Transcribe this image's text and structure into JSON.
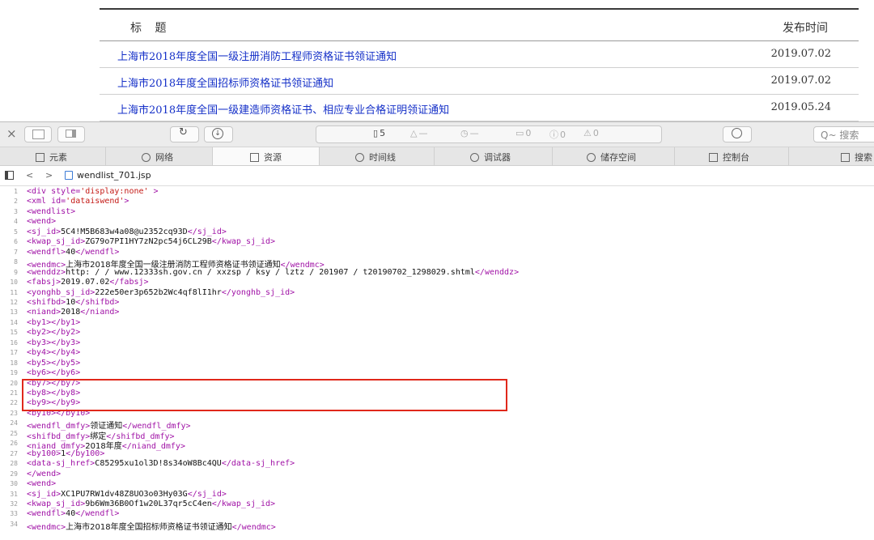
{
  "webpage": {
    "header": {
      "title": "标 题",
      "date": "发布时间"
    },
    "rows": [
      {
        "title": "上海市2018年度全国一级注册消防工程师资格证书领证通知",
        "date": "2019.07.02"
      },
      {
        "title": "上海市2018年度全国招标师资格证书领证通知",
        "date": "2019.07.02"
      },
      {
        "title": "上海市2018年度全国一级建造师资格证书、相应专业合格证明领证通知",
        "date": "2019.05.24"
      }
    ]
  },
  "devtools": {
    "toolbar": {
      "close": "×",
      "counts": [
        {
          "icon": "document-icon",
          "value": "5"
        },
        {
          "icon": "weight-icon",
          "value": "—"
        },
        {
          "icon": "clock-icon",
          "value": "—"
        },
        {
          "icon": "log-icon",
          "value": "0"
        },
        {
          "icon": "info-icon",
          "value": "0"
        },
        {
          "icon": "warning-icon",
          "value": "0"
        }
      ],
      "search_placeholder": "Q~ 搜索"
    },
    "tabs": [
      {
        "label": "元素",
        "icon": "elements-icon"
      },
      {
        "label": "网络",
        "icon": "network-icon"
      },
      {
        "label": "资源",
        "icon": "resources-icon",
        "active": true
      },
      {
        "label": "时间线",
        "icon": "timeline-icon"
      },
      {
        "label": "调试器",
        "icon": "debugger-icon"
      },
      {
        "label": "储存空间",
        "icon": "storage-icon"
      },
      {
        "label": "控制台",
        "icon": "console-icon"
      },
      {
        "label": "搜索",
        "icon": "search-icon"
      }
    ],
    "path": {
      "file": "wendlist_701.jsp"
    },
    "code_lines": [
      {
        "n": "1",
        "parts": [
          [
            "t",
            "<div "
          ],
          [
            "t",
            "style="
          ],
          [
            "a",
            "'display:none'"
          ],
          [
            "t",
            " >"
          ]
        ]
      },
      {
        "n": "2",
        "parts": [
          [
            "t",
            "<xml "
          ],
          [
            "t",
            "id="
          ],
          [
            "a",
            "'dataiswend'"
          ],
          [
            "t",
            ">"
          ]
        ]
      },
      {
        "n": "3",
        "parts": [
          [
            "t",
            "<wendlist>"
          ]
        ]
      },
      {
        "n": "4",
        "parts": [
          [
            "t",
            "<wend>"
          ]
        ]
      },
      {
        "n": "5",
        "parts": [
          [
            "t",
            "<sj_id>"
          ],
          [
            "x",
            "5C4!M5B683w4a08@u2352cq93D"
          ],
          [
            "t",
            "</sj_id>"
          ]
        ]
      },
      {
        "n": "6",
        "parts": [
          [
            "t",
            "<kwap_sj_id>"
          ],
          [
            "x",
            "ZG79o7PI1HY7zN2pc54j6CL29B"
          ],
          [
            "t",
            "</kwap_sj_id>"
          ]
        ]
      },
      {
        "n": "7",
        "parts": [
          [
            "t",
            "<wendfl>"
          ],
          [
            "x",
            "40"
          ],
          [
            "t",
            "</wendfl>"
          ]
        ]
      },
      {
        "n": "8",
        "parts": [
          [
            "t",
            "<wendmc>"
          ],
          [
            "c",
            "上海市2018年度全国一级注册消防工程师资格证书领证通知"
          ],
          [
            "t",
            "</wendmc>"
          ]
        ]
      },
      {
        "n": "9",
        "parts": [
          [
            "t",
            "<wenddz>"
          ],
          [
            "x",
            "http: / / www.12333sh.gov.cn / xxzsp / ksy / lztz / 201907 / t20190702_1298029.shtml"
          ],
          [
            "t",
            "</wenddz>"
          ]
        ]
      },
      {
        "n": "10",
        "parts": [
          [
            "t",
            "<fabsj>"
          ],
          [
            "x",
            "2019.07.02"
          ],
          [
            "t",
            "</fabsj>"
          ]
        ]
      },
      {
        "n": "11",
        "parts": [
          [
            "t",
            "<yonghb_sj_id>"
          ],
          [
            "x",
            "222e50er3p652b2Wc4qf8lI1hr"
          ],
          [
            "t",
            "</yonghb_sj_id>"
          ]
        ]
      },
      {
        "n": "12",
        "parts": [
          [
            "t",
            "<shifbd>"
          ],
          [
            "x",
            "10"
          ],
          [
            "t",
            "</shifbd>"
          ]
        ]
      },
      {
        "n": "13",
        "parts": [
          [
            "t",
            "<niand>"
          ],
          [
            "x",
            "2018"
          ],
          [
            "t",
            "</niand>"
          ]
        ]
      },
      {
        "n": "14",
        "parts": [
          [
            "t",
            "<by1></by1>"
          ]
        ]
      },
      {
        "n": "15",
        "parts": [
          [
            "t",
            "<by2></by2>"
          ]
        ]
      },
      {
        "n": "16",
        "parts": [
          [
            "t",
            "<by3></by3>"
          ]
        ]
      },
      {
        "n": "17",
        "parts": [
          [
            "t",
            "<by4></by4>"
          ]
        ]
      },
      {
        "n": "18",
        "parts": [
          [
            "t",
            "<by5></by5>"
          ]
        ]
      },
      {
        "n": "19",
        "parts": [
          [
            "t",
            "<by6></by6>"
          ]
        ]
      },
      {
        "n": "20",
        "parts": [
          [
            "t",
            "<by7></by7>"
          ]
        ]
      },
      {
        "n": "21",
        "parts": [
          [
            "t",
            "<by8></by8>"
          ]
        ]
      },
      {
        "n": "22",
        "parts": [
          [
            "t",
            "<by9></by9>"
          ]
        ]
      },
      {
        "n": "23",
        "parts": [
          [
            "t",
            "<by10></by10>"
          ]
        ]
      },
      {
        "n": "24",
        "parts": [
          [
            "t",
            "<wendfl_dmfy>"
          ],
          [
            "c",
            "领证通知"
          ],
          [
            "t",
            "</wendfl_dmfy>"
          ]
        ]
      },
      {
        "n": "25",
        "parts": [
          [
            "t",
            "<shifbd_dmfy>"
          ],
          [
            "c",
            "绑定"
          ],
          [
            "t",
            "</shifbd_dmfy>"
          ]
        ]
      },
      {
        "n": "26",
        "parts": [
          [
            "t",
            "<niand_dmfy>"
          ],
          [
            "c",
            "2018年度"
          ],
          [
            "t",
            "</niand_dmfy>"
          ]
        ]
      },
      {
        "n": "27",
        "parts": [
          [
            "t",
            "<by100>"
          ],
          [
            "x",
            "1"
          ],
          [
            "t",
            "</by100>"
          ]
        ]
      },
      {
        "n": "28",
        "parts": [
          [
            "t",
            "<data-sj_href>"
          ],
          [
            "x",
            "C85295xu1ol3D!8s34oW8Bc4QU"
          ],
          [
            "t",
            "</data-sj_href>"
          ]
        ]
      },
      {
        "n": "29",
        "parts": [
          [
            "t",
            "</wend>"
          ]
        ]
      },
      {
        "n": "30",
        "parts": [
          [
            "t",
            "<wend>"
          ]
        ]
      },
      {
        "n": "31",
        "parts": [
          [
            "t",
            "<sj_id>"
          ],
          [
            "x",
            "XC1PU7RW1dv48Z8UO3o03Hy03G"
          ],
          [
            "t",
            "</sj_id>"
          ]
        ]
      },
      {
        "n": "32",
        "parts": [
          [
            "t",
            "<kwap_sj_id>"
          ],
          [
            "x",
            "9b6Wm36B0Of1w20L37qr5cC4en"
          ],
          [
            "t",
            "</kwap_sj_id>"
          ]
        ]
      },
      {
        "n": "33",
        "parts": [
          [
            "t",
            "<wendfl>"
          ],
          [
            "x",
            "40"
          ],
          [
            "t",
            "</wendfl>"
          ]
        ]
      },
      {
        "n": "34",
        "parts": [
          [
            "t",
            "<wendmc>"
          ],
          [
            "c",
            "上海市2018年度全国招标师资格证书领证通知"
          ],
          [
            "t",
            "</wendmc>"
          ]
        ]
      }
    ]
  }
}
